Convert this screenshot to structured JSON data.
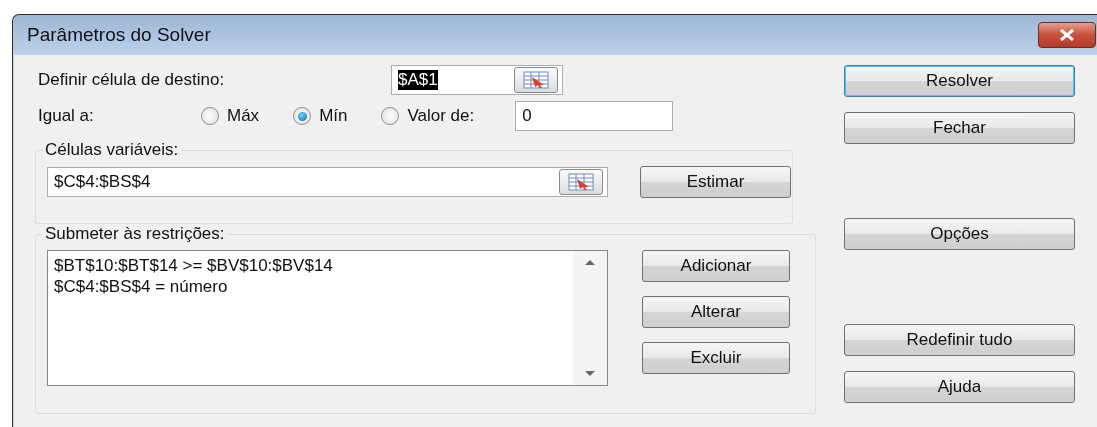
{
  "window": {
    "title": "Parâmetros do Solver"
  },
  "target_cell": {
    "label": "Definir célula de destino:",
    "value": "$A$1",
    "highlighted": true
  },
  "equal_to": {
    "label": "Igual a:",
    "options": [
      {
        "label": "Máx",
        "selected": false
      },
      {
        "label": "Mín",
        "selected": true
      },
      {
        "label": "Valor de:",
        "selected": false
      }
    ],
    "value": "0"
  },
  "changing_cells": {
    "title": "Células variáveis:",
    "value": "$C$4:$BS$4",
    "button": "Estimar"
  },
  "constraints": {
    "title": "Submeter às restrições:",
    "items": [
      "$BT$10:$BT$14 >= $BV$10:$BV$14",
      "$C$4:$BS$4 = número"
    ],
    "buttons": [
      "Adicionar",
      "Alterar",
      "Excluir"
    ]
  },
  "side_button_groups": [
    [
      {
        "label": "Resolver",
        "default": true
      },
      {
        "label": "Fechar",
        "default": false
      }
    ],
    [
      {
        "label": "Opções",
        "default": false
      }
    ],
    [
      {
        "label": "Redefinir tudo",
        "default": false
      },
      {
        "label": "Ajuda",
        "default": false
      }
    ]
  ]
}
